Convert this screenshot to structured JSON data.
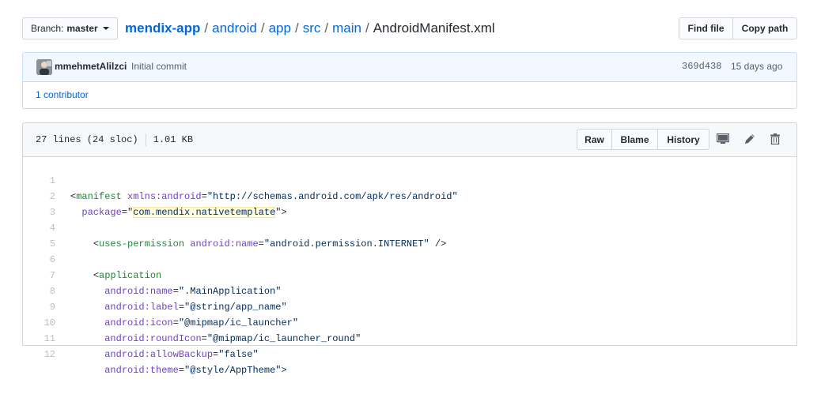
{
  "branch": {
    "prefix": "Branch:",
    "name": "master"
  },
  "breadcrumb": {
    "repo": "mendix-app",
    "dirs": [
      "android",
      "app",
      "src",
      "main"
    ],
    "separator": "/",
    "file": "AndroidManifest.xml"
  },
  "actions": {
    "find_file": "Find file",
    "copy_path": "Copy path"
  },
  "commit": {
    "author": "mmehmetAlilzci",
    "message": "Initial commit",
    "sha": "369d438",
    "time": "15 days ago"
  },
  "contributors": {
    "text": "1 contributor"
  },
  "file": {
    "lines_info": "27 lines (24 sloc)",
    "size": "1.01 KB",
    "raw": "Raw",
    "blame": "Blame",
    "history": "History"
  },
  "icons": [
    "desktop-icon",
    "pencil-icon",
    "trash-icon"
  ],
  "code": {
    "line_numbers": [
      "1",
      "2",
      "3",
      "4",
      "5",
      "6",
      "7",
      "8",
      "9",
      "10",
      "11",
      "12"
    ],
    "l1": {
      "open": "<",
      "tag": "manifest",
      "attr": "xmlns:android",
      "eq": "=",
      "val": "\"http://schemas.android.com/apk/res/android\""
    },
    "l2": {
      "attr": "package",
      "eq": "=\"",
      "val": "com.mendix.nativetemplate",
      "close": "\">"
    },
    "l4": {
      "open": "<",
      "tag": "uses-permission",
      "attr": "android:name",
      "eq": "=",
      "val": "\"android.permission.INTERNET\"",
      "close": " />"
    },
    "l6": {
      "open": "<",
      "tag": "application"
    },
    "l7": {
      "attr": "android:name",
      "eq": "=",
      "val": "\".MainApplication\""
    },
    "l8": {
      "attr": "android:label",
      "eq": "=",
      "val": "\"@string/app_name\""
    },
    "l9": {
      "attr": "android:icon",
      "eq": "=",
      "val": "\"@mipmap/ic_launcher\""
    },
    "l10": {
      "attr": "android:roundIcon",
      "eq": "=",
      "val": "\"@mipmap/ic_launcher_round\""
    },
    "l11": {
      "attr": "android:allowBackup",
      "eq": "=",
      "val": "\"false\""
    },
    "l12": {
      "attr": "android:theme",
      "eq": "=",
      "val": "\"@style/AppTheme\">"
    }
  }
}
